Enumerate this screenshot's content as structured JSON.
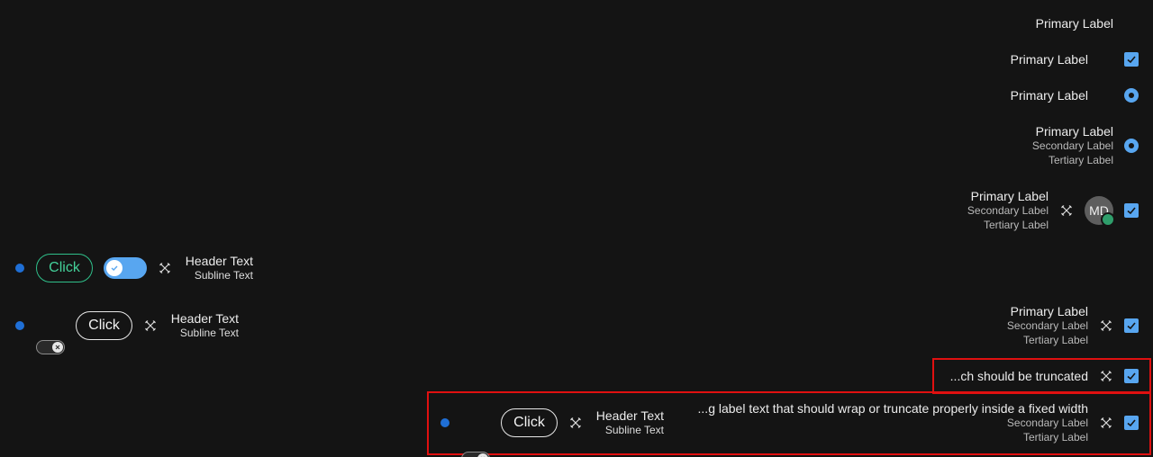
{
  "rows": {
    "r1": {
      "primary": "Primary Label"
    },
    "r2": {
      "primary": "Primary Label"
    },
    "r3": {
      "primary": "Primary Label"
    },
    "r4": {
      "primary": "Primary Label",
      "secondary": "Secondary Label",
      "tertiary": "Tertiary Label"
    },
    "r5": {
      "primary": "Primary Label",
      "secondary": "Secondary Label",
      "tertiary": "Tertiary Label",
      "avatar_initials": "MD"
    },
    "r6": {
      "button": "Click",
      "header": "Header Text",
      "subline": "Subline Text"
    },
    "r7": {
      "button": "Click",
      "header": "Header Text",
      "subline": "Subline Text"
    },
    "r8": {
      "primary": "Primary Label",
      "secondary": "Secondary Label",
      "tertiary": "Tertiary Label"
    },
    "r9": {
      "primary": "...ch should be truncated"
    },
    "r10": {
      "button": "Click",
      "header": "Header Text",
      "subline": "Subline Text",
      "primary": "...g label text that should wrap or truncate properly inside a fixed width",
      "secondary": "Secondary Label",
      "tertiary": "Tertiary Label"
    }
  },
  "colors": {
    "accent": "#58a6f0",
    "dot": "#1f6fd6",
    "green": "#2fbf8a",
    "highlight": "#e01010",
    "background": "#141414"
  },
  "icons": {
    "checkbox": "check-icon",
    "tool": "crossed-tools-icon",
    "toggle_on": "check-icon",
    "toggle_off": "x-icon"
  }
}
